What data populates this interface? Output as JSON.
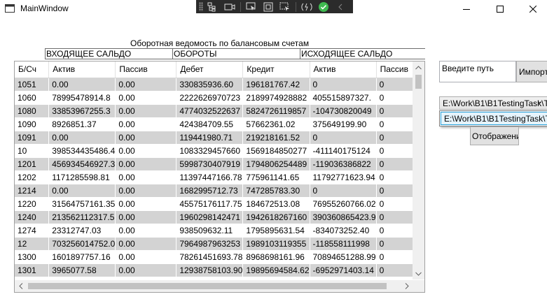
{
  "window": {
    "title": "MainWindow"
  },
  "report": {
    "caption": "Оборотная ведомость по балансовым счетам",
    "groups": [
      "ВХОДЯЩЕЕ САЛЬДО",
      "ОБОРОТЫ",
      "ИСХОДЯЩЕЕ САЛЬДО"
    ]
  },
  "grid": {
    "columns": [
      "Б/Сч",
      "Актив",
      "Пассив",
      "Дебет",
      "Кредит",
      "Актив",
      "Пассив"
    ],
    "rows": [
      [
        "1051",
        "0.00",
        "0.00",
        "330835936.60",
        "196181767.42",
        "0",
        "0"
      ],
      [
        "1060",
        "78995478914.8",
        "0.00",
        "2222626970723",
        "2189974928882",
        "405515897327.",
        "0"
      ],
      [
        "1080",
        "33853967255.3",
        "0.00",
        "4774032522637",
        "5824726119857",
        "-104730820049",
        "0"
      ],
      [
        "1090",
        "8926851.37",
        "0.00",
        "424384709.55",
        "57662361.02",
        "375649199.90",
        "0"
      ],
      [
        "1091",
        "0.00",
        "0.00",
        "119441980.71",
        "219218161.52",
        "0",
        "0"
      ],
      [
        "10",
        "398534435486.4",
        "0.00",
        "1083329457660",
        "1569184850277",
        "-411140175124",
        "0"
      ],
      [
        "1201",
        "456934546927.3",
        "0.00",
        "5998730407919",
        "1794806254489",
        "-119036386822",
        "0"
      ],
      [
        "1202",
        "1171285598.81",
        "0.00",
        "11397447166.78",
        "775961141.65",
        "11792771623.94",
        "0"
      ],
      [
        "1214",
        "0.00",
        "0.00",
        "1682995712.73",
        "747285783.30",
        "0",
        "0"
      ],
      [
        "1220",
        "31564757161.35",
        "0.00",
        "45575176117.75",
        "184672513.08",
        "76955260766.02",
        "0"
      ],
      [
        "1240",
        "213562112317.5",
        "0.00",
        "1960298142471",
        "1942618267160",
        "390360865423.9",
        "0"
      ],
      [
        "1274",
        "23312747.03",
        "0.00",
        "938509632.11",
        "1795895631.54",
        "-834073252.40",
        "0"
      ],
      [
        "12",
        "703256014752.0",
        "0.00",
        "7964987963253",
        "1989103119355",
        "-118558111998",
        "0"
      ],
      [
        "1300",
        "1601897757.16",
        "0.00",
        "78261451693.78",
        "8968698161.96",
        "70894651288.99",
        "0"
      ],
      [
        "1301",
        "3965077.58",
        "0.00",
        "12938758103.90",
        "19895694584.62",
        "-6952971403.14",
        "0"
      ]
    ]
  },
  "path_input": {
    "placeholder": "Введите путь"
  },
  "buttons": {
    "import_label": "Импорт",
    "show_label": "Отображение"
  },
  "file_combo": {
    "selected": "E:\\Work\\B1\\B1TestingTask\\Ta",
    "option": "E:\\Work\\B1\\B1TestingTask\\Ta"
  }
}
